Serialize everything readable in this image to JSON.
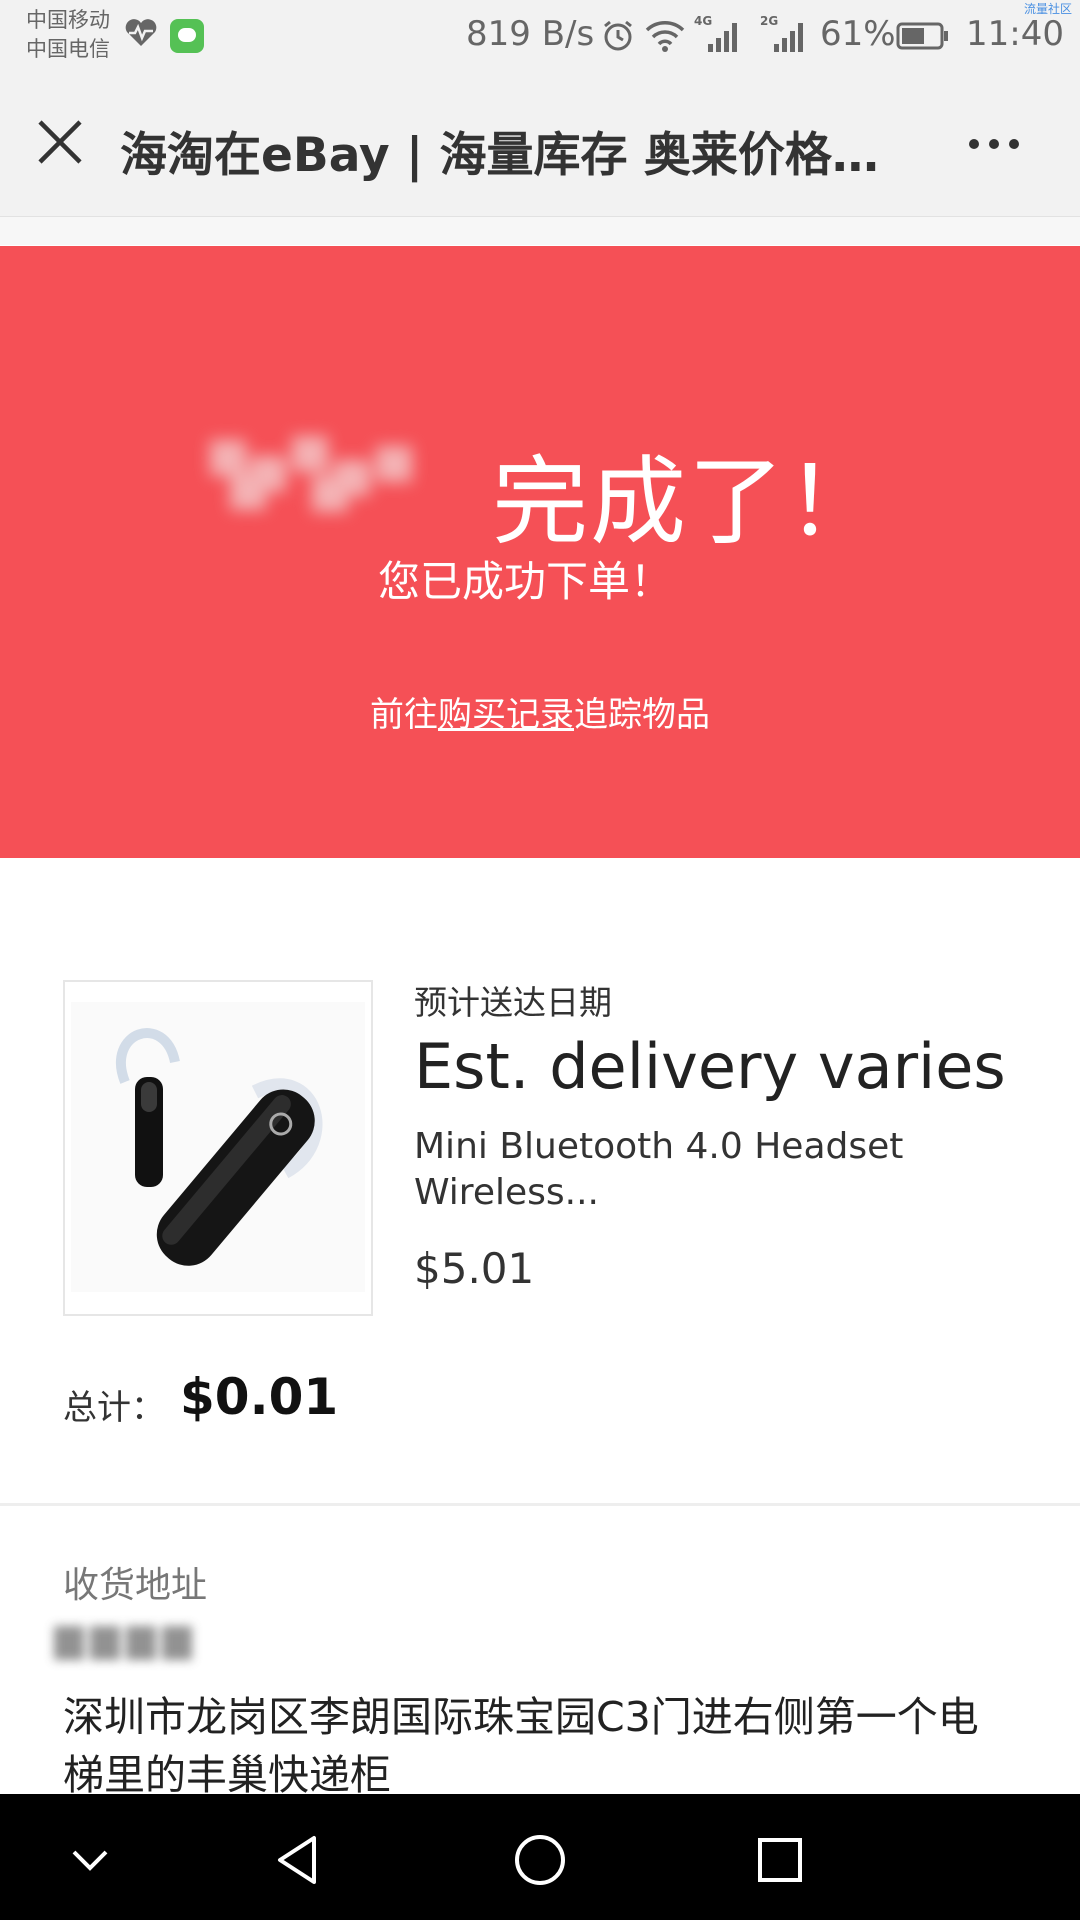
{
  "status_bar": {
    "carrier_1": "中国移动",
    "carrier_2": "中国电信",
    "net_speed": "819 B/s",
    "net_4g_label": "4G",
    "net_2g_label": "2G",
    "battery_percent": "61%",
    "battery_level": 0.61,
    "time": "11:40",
    "watermark": "流量社区"
  },
  "title_bar": {
    "title": "海淘在eBay | 海量库存 奥莱价格…"
  },
  "confirmation": {
    "headline": "完成了！",
    "subtitle": "您已成功下单！",
    "track_prefix": "前往",
    "track_link": "购买记录",
    "track_suffix": "追踪物品"
  },
  "item": {
    "delivery_label": "预计送达日期",
    "delivery_value": "Est. delivery varies",
    "title_line1": "Mini Bluetooth 4.0 Headset",
    "title_line2": "Wireless...",
    "price": "$5.01"
  },
  "summary": {
    "total_label": "总计：",
    "total_value": "$0.01"
  },
  "shipping": {
    "label": "收货地址",
    "address_line1": "深圳市龙岗区李朗国际珠宝园C3门进右侧第一个电",
    "address_line2": "梯里的丰巢快递柜"
  },
  "colors": {
    "banner": "#f55056",
    "status_bar": "#f2f2f2",
    "nav_bar": "#000000"
  }
}
